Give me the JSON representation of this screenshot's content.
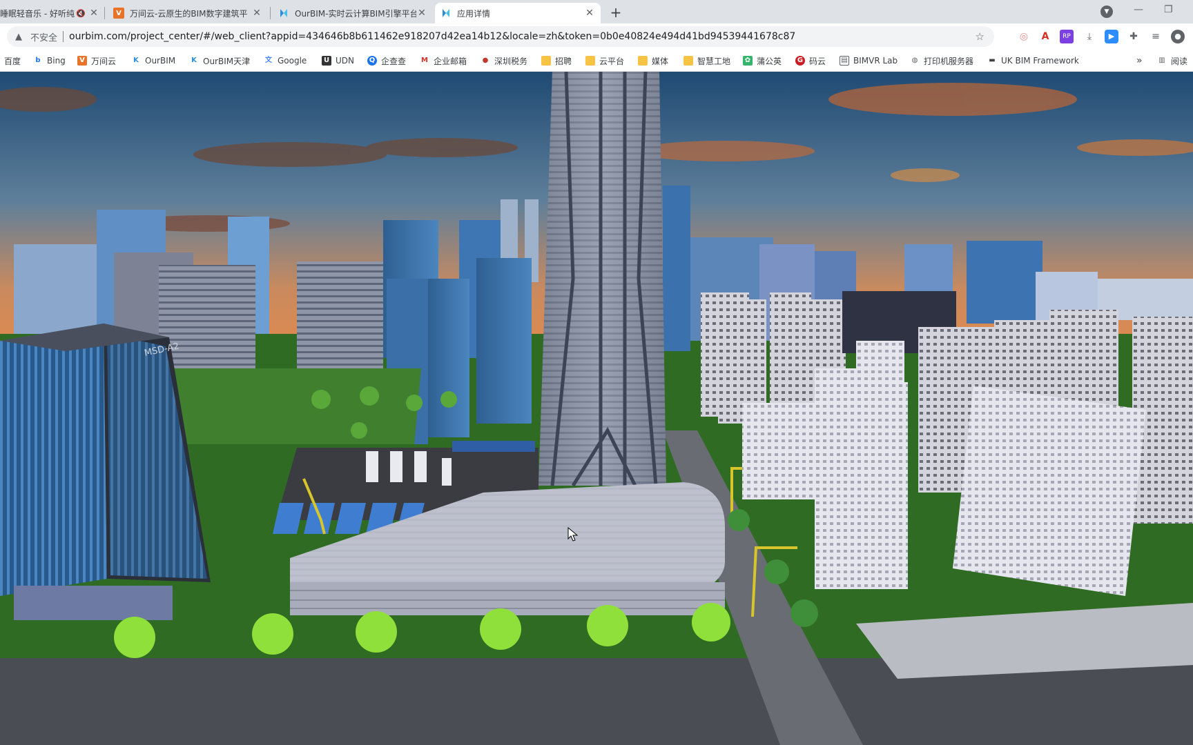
{
  "tabs": [
    {
      "title": "睡眠轻音乐 - 好听纯",
      "active": false,
      "muted": true
    },
    {
      "title": "万间云-云原生的BIM数字建筑平",
      "active": false,
      "muted": false
    },
    {
      "title": "OurBIM-实时云计算BIM引擎平台",
      "active": false,
      "muted": false
    },
    {
      "title": "应用详情",
      "active": true,
      "muted": false
    }
  ],
  "address": {
    "security_label": "不安全",
    "url": "ourbim.com/project_center/#/web_client?appid=434646b8b611462e918207d42ea14b12&locale=zh&token=0b0e40824e494d41bd94539441678c87"
  },
  "bookmarks": [
    {
      "label": "百度",
      "icon": "baidu-icon"
    },
    {
      "label": "Bing",
      "icon": "bing-icon"
    },
    {
      "label": "万间云",
      "icon": "wanjianyun-icon"
    },
    {
      "label": "OurBIM",
      "icon": "ourbim-icon"
    },
    {
      "label": "OurBIM天津",
      "icon": "ourbim-icon"
    },
    {
      "label": "Google",
      "icon": "google-icon"
    },
    {
      "label": "UDN",
      "icon": "udn-icon"
    },
    {
      "label": "企查查",
      "icon": "qichacha-icon"
    },
    {
      "label": "企业邮箱",
      "icon": "mail-icon"
    },
    {
      "label": "深圳税务",
      "icon": "tax-icon"
    },
    {
      "label": "招聘",
      "icon": "folder-icon"
    },
    {
      "label": "云平台",
      "icon": "folder-icon"
    },
    {
      "label": "媒体",
      "icon": "folder-icon"
    },
    {
      "label": "智慧工地",
      "icon": "folder-icon"
    },
    {
      "label": "蒲公英",
      "icon": "pgy-icon"
    },
    {
      "label": "码云",
      "icon": "gitee-icon"
    },
    {
      "label": "BIMVR Lab",
      "icon": "page-icon"
    },
    {
      "label": "打印机服务器",
      "icon": "globe-icon"
    },
    {
      "label": "UK BIM Framework",
      "icon": "page-icon"
    }
  ],
  "bookmarks_overflow": "»",
  "reading_list": "阅读",
  "scene": {
    "building_label": "MSD-A2"
  },
  "colors": {
    "sky_top": "#1f4a73",
    "sky_horizon": "#e58a4b",
    "grass": "#2f6b23",
    "tower": "#7d8698",
    "accent_tab": "#ffffff"
  }
}
